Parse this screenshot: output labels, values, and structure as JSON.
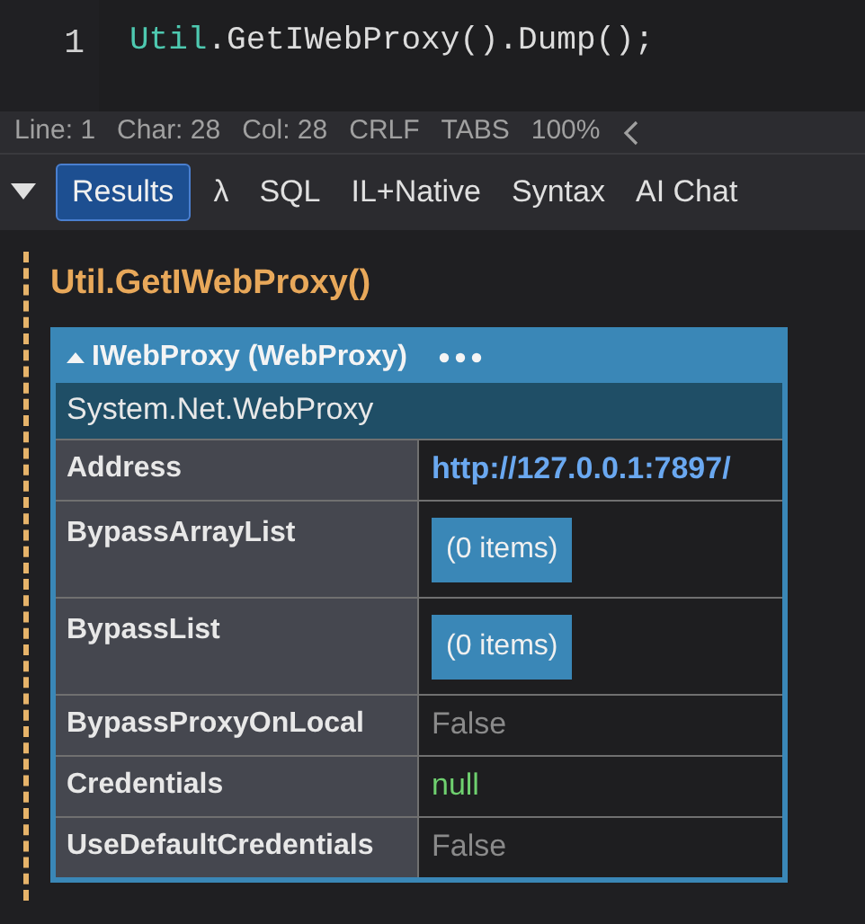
{
  "editor": {
    "line_number": "1",
    "tokens": [
      {
        "kind": "type",
        "text": "Util"
      },
      {
        "kind": "plain",
        "text": ".GetIWebProxy().Dump();"
      }
    ]
  },
  "status_bar": [
    "Line: 1",
    "Char: 28",
    "Col: 28",
    "CRLF",
    "TABS",
    "100%"
  ],
  "tabs": [
    {
      "label": "Results",
      "selected": true
    },
    {
      "label": "λ",
      "selected": false
    },
    {
      "label": "SQL",
      "selected": false
    },
    {
      "label": "IL+Native",
      "selected": false
    },
    {
      "label": "Syntax",
      "selected": false
    },
    {
      "label": "AI Chat",
      "selected": false
    }
  ],
  "result": {
    "title": "Util.GetIWebProxy()",
    "header": "IWebProxy (WebProxy)",
    "expanded": true,
    "type_name": "System.Net.WebProxy",
    "rows": [
      {
        "key": "Address",
        "kind": "link",
        "value": "http://127.0.0.1:7897/"
      },
      {
        "key": "BypassArrayList",
        "kind": "list",
        "value": "(0 items)"
      },
      {
        "key": "BypassList",
        "kind": "list",
        "value": "(0 items)"
      },
      {
        "key": "BypassProxyOnLocal",
        "kind": "bool",
        "value": "False"
      },
      {
        "key": "Credentials",
        "kind": "null",
        "value": "null"
      },
      {
        "key": "UseDefaultCredentials",
        "kind": "bool",
        "value": "False"
      }
    ]
  }
}
